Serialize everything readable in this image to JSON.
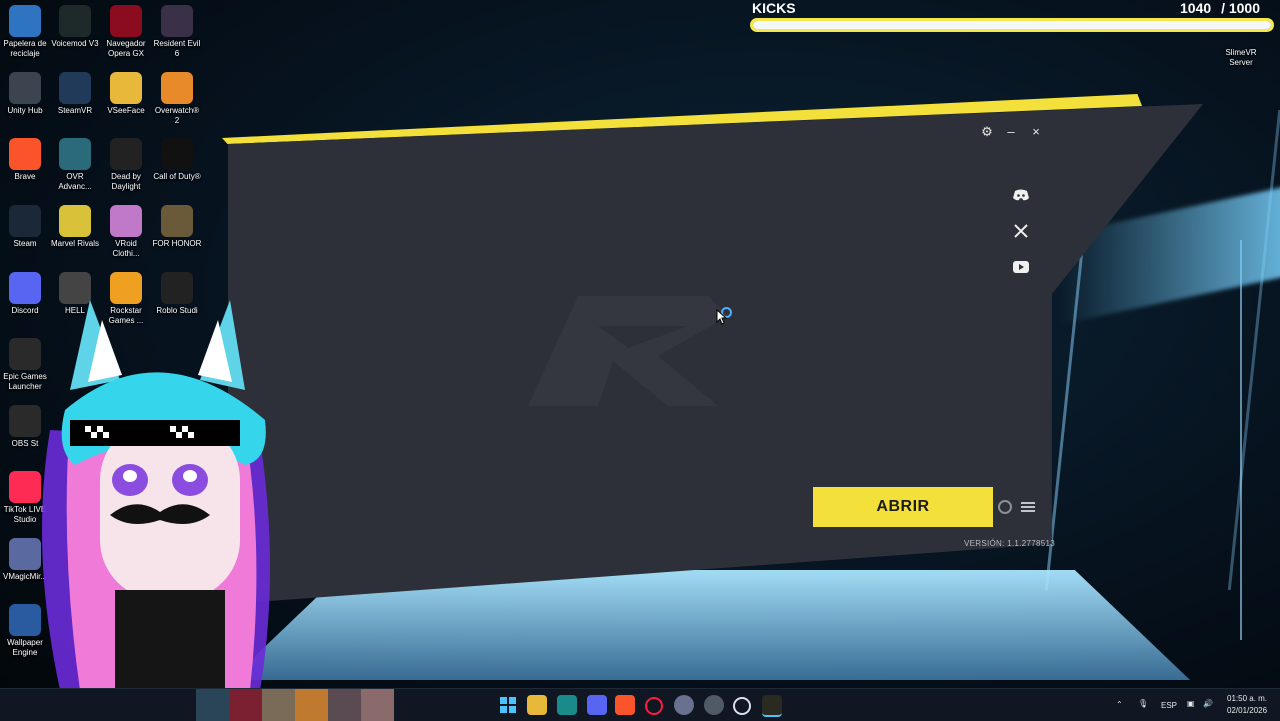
{
  "desktop": {
    "icons": [
      {
        "label": "Papelera de reciclaje"
      },
      {
        "label": "Voicemod V3"
      },
      {
        "label": "Navegador Opera GX"
      },
      {
        "label": "Resident Evil 6"
      },
      {
        "label": "Unity Hub"
      },
      {
        "label": "SteamVR"
      },
      {
        "label": "VSeeFace"
      },
      {
        "label": "Overwatch® 2"
      },
      {
        "label": "Brave"
      },
      {
        "label": "OVR Advanc..."
      },
      {
        "label": "Dead by Daylight"
      },
      {
        "label": "Call of Duty®"
      },
      {
        "label": "Steam"
      },
      {
        "label": "Marvel Rivals"
      },
      {
        "label": "VRoid Clothi..."
      },
      {
        "label": "FOR HONOR"
      },
      {
        "label": "Discord"
      },
      {
        "label": "HELL"
      },
      {
        "label": "Rockstar Games ..."
      },
      {
        "label": "Roblo Studi"
      },
      {
        "label": "Epic Games Launcher"
      },
      {
        "label": "OBS St"
      },
      {
        "label": "TikTok LIVE Studio"
      },
      {
        "label": "VMagicMir..."
      },
      {
        "label": "Wallpaper Engine"
      }
    ],
    "slime_label": "SlimeVR Server"
  },
  "kicks": {
    "label": "KICKS",
    "count": "1040",
    "goal": "/ 1000",
    "progress": 1.0
  },
  "launcher": {
    "button_label": "ABRIR",
    "version": "VERSIÓN: 1.1.2778513",
    "controls": {
      "settings": "⚙",
      "minimize": "–",
      "close": "×"
    },
    "social": [
      "discord-icon",
      "x-icon",
      "youtube-icon"
    ],
    "accent_color": "#f3e03a",
    "panel_color": "#2d3038"
  },
  "taskbar": {
    "lang": "ESP",
    "time": "01:50 a. m.",
    "date": "02/01/2026"
  }
}
